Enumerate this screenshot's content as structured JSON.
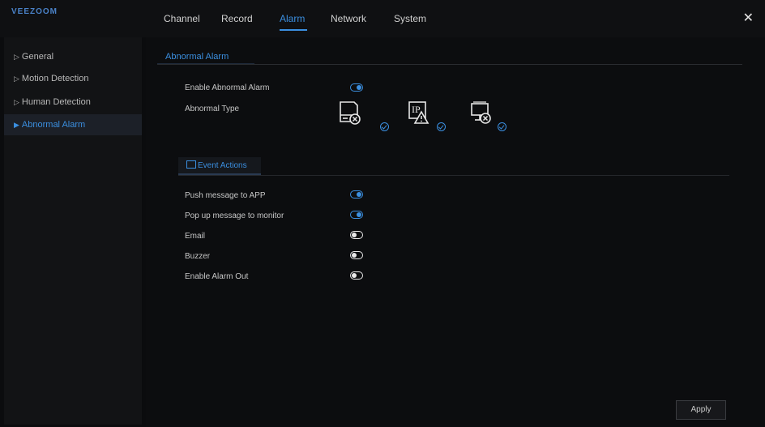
{
  "app": {
    "logo": "VEEZOOM"
  },
  "nav": {
    "tabs": [
      "Channel",
      "Record",
      "Alarm",
      "Network",
      "System"
    ],
    "active": "Alarm"
  },
  "sidebar": {
    "items": [
      {
        "label": "General"
      },
      {
        "label": "Motion Detection"
      },
      {
        "label": "Human Detection"
      },
      {
        "label": "Abnormal Alarm"
      }
    ],
    "active": "Abnormal Alarm"
  },
  "main": {
    "section_title": "Abnormal Alarm",
    "enable_label": "Enable Abnormal Alarm",
    "enable_on": true,
    "type_label": "Abnormal Type",
    "types": [
      {
        "icon": "disk-error-icon",
        "checked": true
      },
      {
        "icon": "ip-conflict-icon",
        "checked": true
      },
      {
        "icon": "network-disconnect-icon",
        "checked": true
      }
    ],
    "event_tab": "Event Actions",
    "actions": [
      {
        "label": "Push message to APP",
        "on": true
      },
      {
        "label": "Pop up message to monitor",
        "on": true
      },
      {
        "label": "Email",
        "on": false
      },
      {
        "label": "Buzzer",
        "on": false
      },
      {
        "label": "Enable Alarm Out",
        "on": false
      }
    ],
    "apply_label": "Apply"
  },
  "colors": {
    "accent": "#3b8fe0",
    "background": "#0b0c0e"
  }
}
